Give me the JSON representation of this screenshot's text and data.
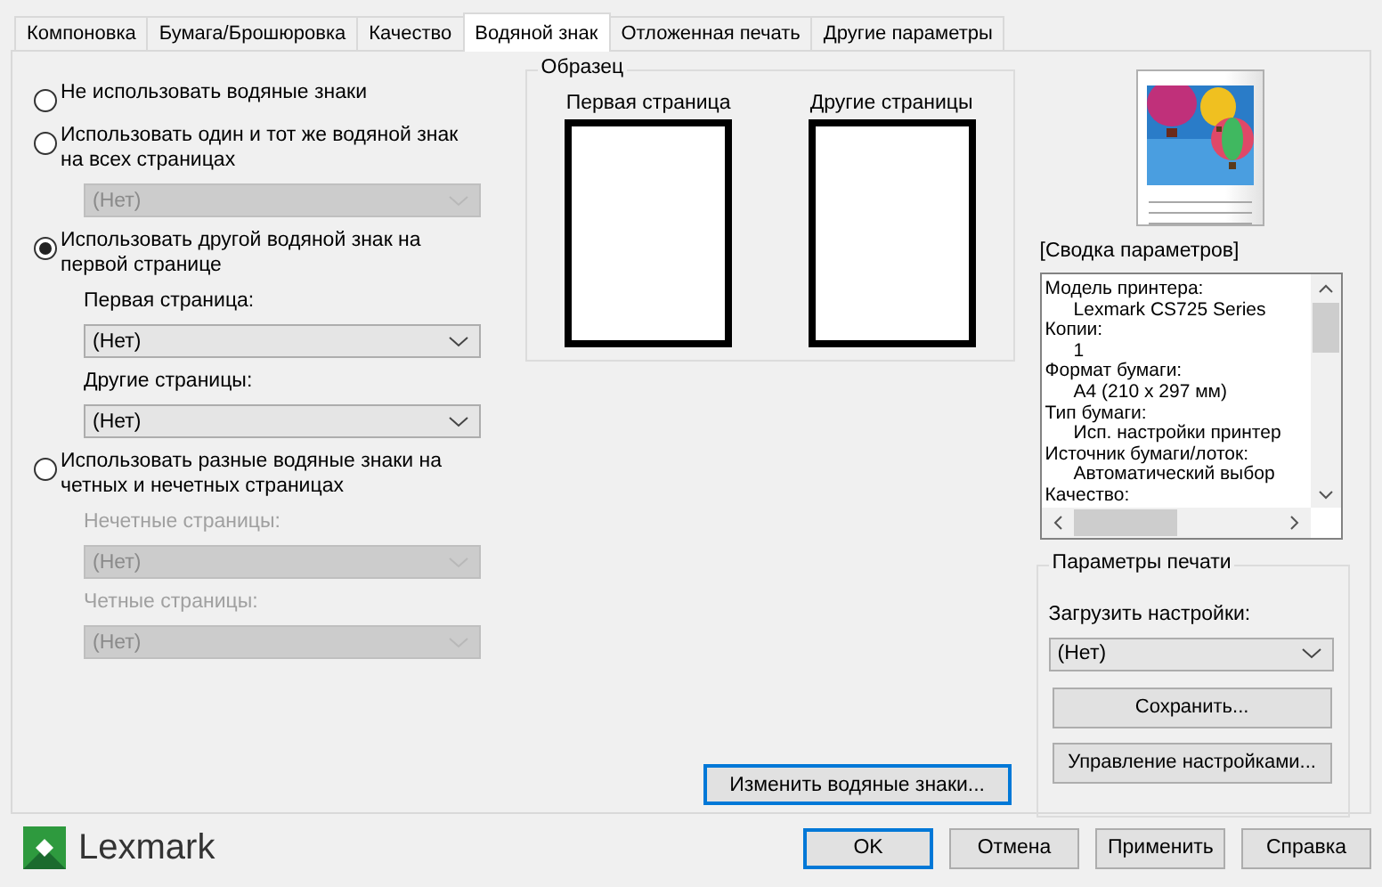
{
  "tabs": [
    {
      "label": "Компоновка",
      "selected": false
    },
    {
      "label": "Бумага/Брошюровка",
      "selected": false
    },
    {
      "label": "Качество",
      "selected": false
    },
    {
      "label": "Водяной знак",
      "selected": true
    },
    {
      "label": "Отложенная печать",
      "selected": false
    },
    {
      "label": "Другие параметры",
      "selected": false
    }
  ],
  "options": [
    {
      "label": "Не использовать водяные знаки",
      "selected": false
    },
    {
      "label": "Использовать один и тот же водяной знак на всех страницах",
      "selected": false,
      "fields": [
        {
          "value": "(Нет)",
          "disabled": true
        }
      ]
    },
    {
      "label": "Использовать другой водяной знак на первой странице",
      "selected": true,
      "fields": [
        {
          "label": "Первая страница:",
          "value": "(Нет)",
          "disabled": false
        },
        {
          "label": "Другие страницы:",
          "value": "(Нет)",
          "disabled": false
        }
      ]
    },
    {
      "label": "Использовать разные водяные знаки на четных и нечетных страницах",
      "selected": false,
      "fields": [
        {
          "label": "Нечетные страницы:",
          "value": "(Нет)",
          "disabled": true
        },
        {
          "label": "Четные страницы:",
          "value": "(Нет)",
          "disabled": true
        }
      ]
    }
  ],
  "sample": {
    "title": "Образец",
    "pages": [
      "Первая страница",
      "Другие страницы"
    ]
  },
  "edit_button": "Изменить водяные знаки...",
  "summary": {
    "title": "[Сводка параметров]",
    "items": [
      {
        "label": "Модель принтера:",
        "value": "Lexmark CS725 Series"
      },
      {
        "label": "Копии:",
        "value": "1"
      },
      {
        "label": "Формат бумаги:",
        "value": "A4 (210 x 297 мм)"
      },
      {
        "label": "Тип бумаги:",
        "value": "Исп. настройки принтер"
      },
      {
        "label": "Источник бумаги/лоток:",
        "value": "Автоматический выбор"
      },
      {
        "label": "Качество:"
      }
    ]
  },
  "print_settings": {
    "title": "Параметры печати",
    "load_label": "Загрузить настройки:",
    "load_value": "(Нет)",
    "buttons": [
      "Сохранить...",
      "Управление настройками..."
    ]
  },
  "logo": "Lexmark",
  "buttons": [
    {
      "label": "OK",
      "default": true
    },
    {
      "label": "Отмена",
      "default": false
    },
    {
      "label": "Применить",
      "default": false
    },
    {
      "label": "Справка",
      "default": false
    }
  ]
}
